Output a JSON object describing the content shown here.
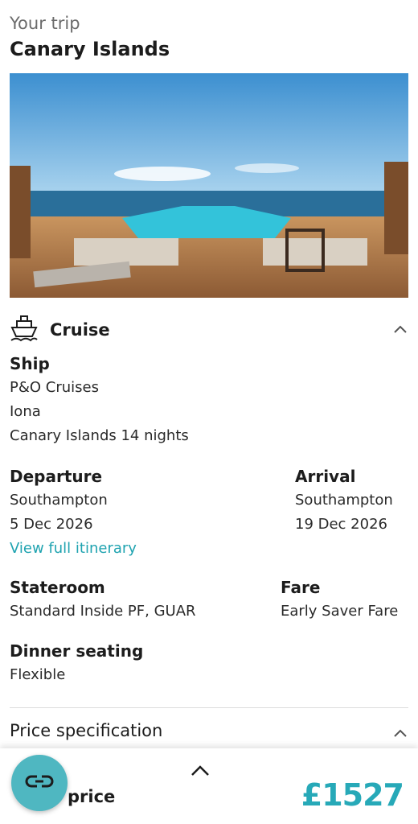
{
  "header": {
    "eyebrow": "Your trip",
    "title": "Canary Islands"
  },
  "hero": {
    "alt": "Cruise ship pool deck with ocean view"
  },
  "cruise": {
    "section_title": "Cruise",
    "ship": {
      "label": "Ship",
      "line": "P&O Cruises",
      "name": "Iona",
      "itinerary": "Canary Islands 14 nights"
    },
    "departure": {
      "label": "Departure",
      "port": "Southampton",
      "date": "5 Dec 2026"
    },
    "arrival": {
      "label": "Arrival",
      "port": "Southampton",
      "date": "19 Dec 2026"
    },
    "itinerary_link": "View full itinerary",
    "stateroom": {
      "label": "Stateroom",
      "value": "Standard Inside PF, GUAR"
    },
    "fare": {
      "label": "Fare",
      "value": "Early Saver Fare"
    },
    "dinner": {
      "label": "Dinner seating",
      "value": "Flexible"
    }
  },
  "price_spec": {
    "label": "Price specification"
  },
  "bottom_bar": {
    "total_label": "price",
    "total_price": "£1527"
  },
  "colors": {
    "accent": "#27a9b8",
    "link": "#1fa3b0",
    "fab": "#4fb7c1"
  },
  "icons": [
    "ship-icon",
    "chevron-up-icon",
    "chat-icon"
  ]
}
